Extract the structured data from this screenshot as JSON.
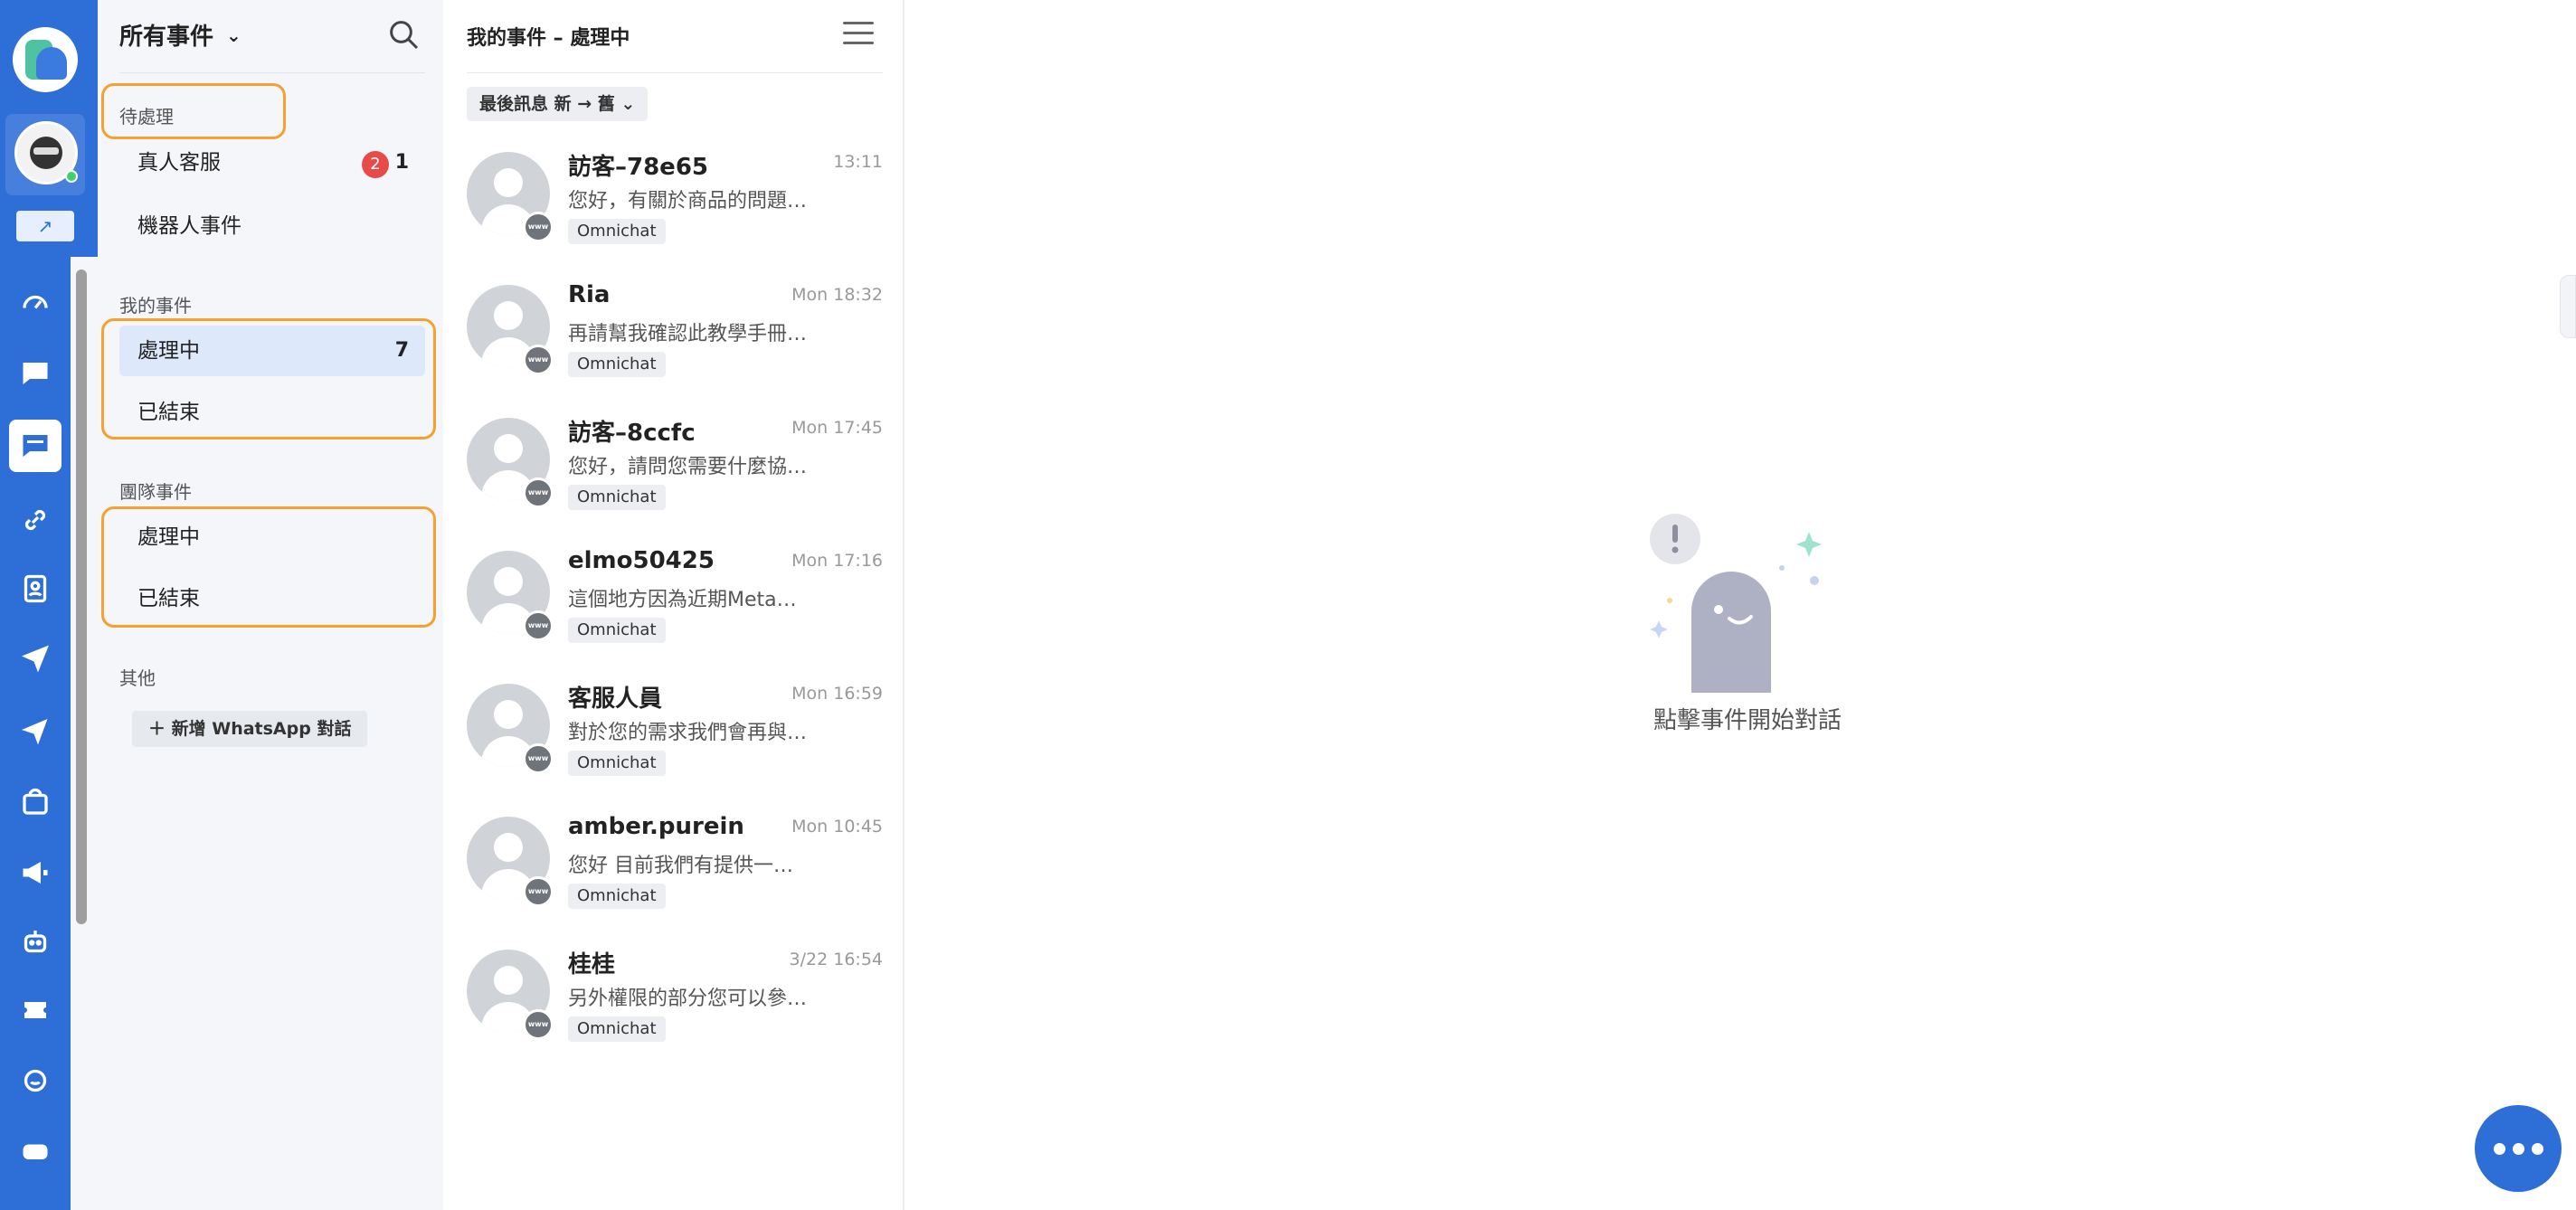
{
  "rail": {
    "icons": [
      "dashboard-icon",
      "chat-icon",
      "chat-active-icon",
      "link-icon",
      "contacts-icon",
      "send-icon",
      "broadcast-send-icon",
      "store-icon",
      "megaphone-icon",
      "bot-icon",
      "ticket-icon",
      "agent-icon",
      "game-icon"
    ],
    "accent": "#2d6fd6"
  },
  "nav": {
    "title": "所有事件",
    "sections": {
      "pending": {
        "label": "待處理",
        "items": [
          {
            "label": "真人客服",
            "badge": "2",
            "count": "1"
          },
          {
            "label": "機器人事件"
          }
        ]
      },
      "mine": {
        "label": "我的事件",
        "items": [
          {
            "label": "處理中",
            "count": "7"
          },
          {
            "label": "已結束"
          }
        ]
      },
      "team": {
        "label": "團隊事件",
        "items": [
          {
            "label": "處理中"
          },
          {
            "label": "已結束"
          }
        ]
      },
      "other": {
        "label": "其他",
        "add_label": "新增 WhatsApp 對話"
      }
    },
    "highlight_color": "#f4a12f"
  },
  "list": {
    "title": "我的事件 – 處理中",
    "sort_label": "最後訊息 新 → 舊",
    "conversations": [
      {
        "name": "訪客–78e65",
        "time": "13:11",
        "preview": "您好，有關於商品的問題…",
        "tag": "Omnichat"
      },
      {
        "name": "Ria",
        "time": "Mon 18:32",
        "preview": "再請幫我確認此教學手冊…",
        "tag": "Omnichat"
      },
      {
        "name": "訪客–8ccfc",
        "time": "Mon 17:45",
        "preview": "您好，請問您需要什麼協…",
        "tag": "Omnichat"
      },
      {
        "name": "elmo50425",
        "time": "Mon 17:16",
        "preview": "這個地方因為近期Meta…",
        "tag": "Omnichat"
      },
      {
        "name": "客服人員",
        "time": "Mon 16:59",
        "preview": "對於您的需求我們會再與…",
        "tag": "Omnichat"
      },
      {
        "name": "amber.purein",
        "time": "Mon 10:45",
        "preview": "您好 目前我們有提供一…",
        "tag": "Omnichat"
      },
      {
        "name": "桂桂",
        "time": "3/22 16:54",
        "preview": "另外權限的部分您可以參…",
        "tag": "Omnichat"
      }
    ],
    "channel_badge": "www"
  },
  "main": {
    "empty_text": "點擊事件開始對話"
  }
}
